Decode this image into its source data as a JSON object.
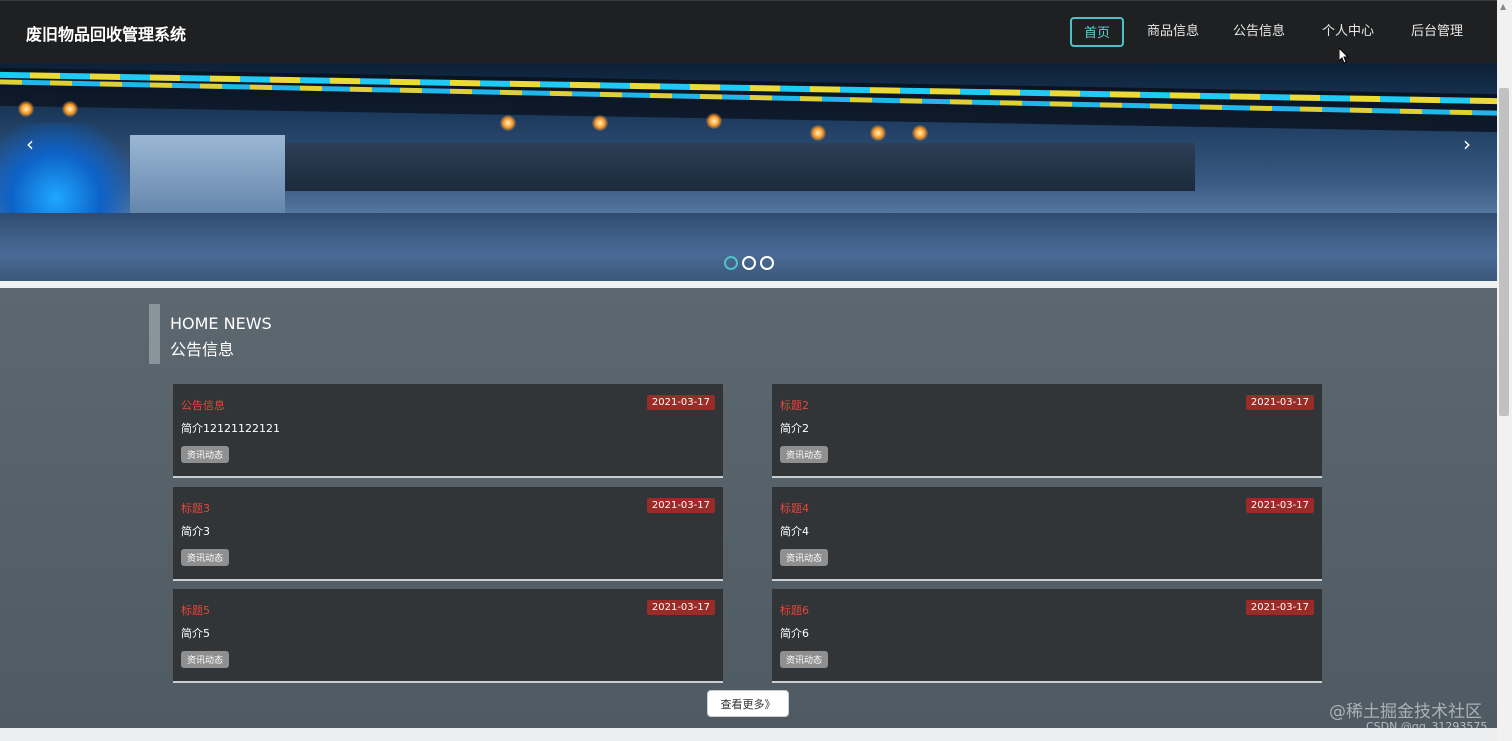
{
  "header": {
    "brand": "废旧物品回收管理系统",
    "nav": [
      "首页",
      "商品信息",
      "公告信息",
      "个人中心",
      "后台管理"
    ],
    "active_index": 0
  },
  "banner": {
    "prev_icon": "chevron-left-icon",
    "next_icon": "chevron-right-icon",
    "prev_glyph": "‹",
    "next_glyph": "›",
    "slide_count": 3,
    "active_slide": 0
  },
  "section": {
    "title_en": "HOME NEWS",
    "title_zh": "公告信息"
  },
  "news": [
    {
      "title": "公告信息",
      "date": "2021-03-17",
      "desc": "简介12121122121",
      "tag": "资讯动态"
    },
    {
      "title": "标题2",
      "date": "2021-03-17",
      "desc": "简介2",
      "tag": "资讯动态"
    },
    {
      "title": "标题3",
      "date": "2021-03-17",
      "desc": "简介3",
      "tag": "资讯动态"
    },
    {
      "title": "标题4",
      "date": "2021-03-17",
      "desc": "简介4",
      "tag": "资讯动态"
    },
    {
      "title": "标题5",
      "date": "2021-03-17",
      "desc": "简介5",
      "tag": "资讯动态"
    },
    {
      "title": "标题6",
      "date": "2021-03-17",
      "desc": "简介6",
      "tag": "资讯动态"
    }
  ],
  "more_button": "查看更多》",
  "watermarks": [
    "@稀土掘金技术社区",
    "CSDN @qq_31293575"
  ],
  "colors": {
    "accent": "#4fc1c6",
    "title_red": "#e5463a",
    "date_badge": "#9b2b26",
    "topbar": "#1f2021"
  }
}
